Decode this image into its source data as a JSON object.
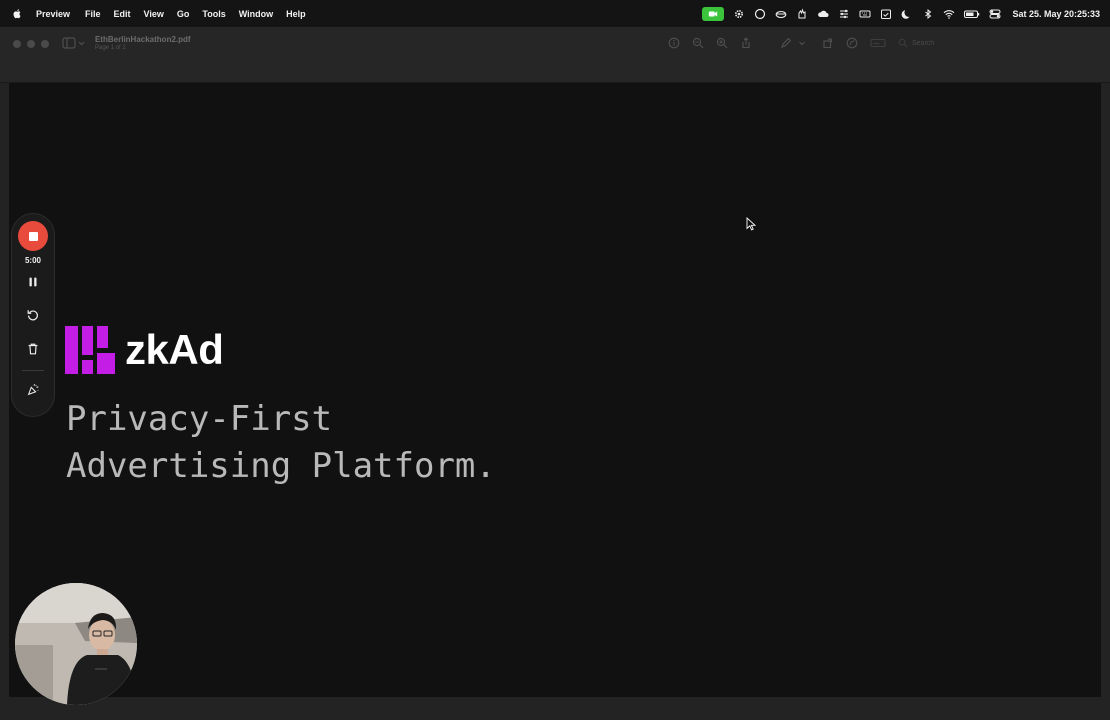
{
  "menubar": {
    "app_name": "Preview",
    "menus": [
      "File",
      "Edit",
      "View",
      "Go",
      "Tools",
      "Window",
      "Help"
    ],
    "clock": "Sat 25. May  20:25:33"
  },
  "window": {
    "doc_title": "EthBerlinHackathon2.pdf",
    "doc_subtitle": "Page 1 of 2",
    "search_placeholder": "Search"
  },
  "slide": {
    "logo_text": "zkAd",
    "tagline": "Privacy-First\nAdvertising Platform.",
    "logo_color": "#c41ee6"
  },
  "recorder": {
    "timer": "5:00"
  }
}
